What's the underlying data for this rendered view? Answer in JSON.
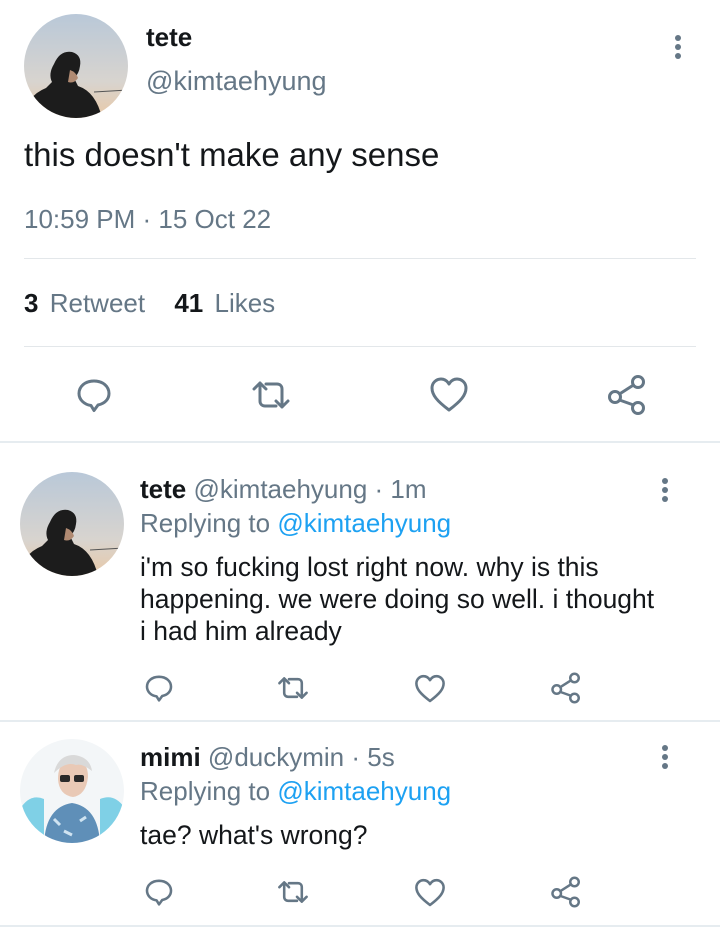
{
  "main_tweet": {
    "display_name": "tete",
    "handle": "@kimtaehyung",
    "text": "this doesn't make any sense",
    "timestamp": "10:59 PM · 15 Oct 22",
    "retweet_count": "3",
    "retweet_label": "Retweet",
    "like_count": "41",
    "like_label": "Likes"
  },
  "replies": [
    {
      "display_name": "tete",
      "handle_time": "@kimtaehyung · 1m",
      "replying_prefix": "Replying to",
      "replying_to": "@kimtaehyung",
      "text": "i'm so fucking lost right now. why is this happening. we were doing so well. i thought i had him already"
    },
    {
      "display_name": "mimi",
      "handle_time": "@duckymin · 5s",
      "replying_prefix": "Replying to",
      "replying_to": "@kimtaehyung",
      "text": "tae? what's wrong?"
    }
  ],
  "icons": {
    "reply": "comment-icon",
    "retweet": "retweet-icon",
    "like": "heart-icon",
    "share": "share-icon",
    "menu": "more-vertical-icon"
  },
  "colors": {
    "link": "#1da1f2",
    "muted": "#657786",
    "icon": "#657786"
  }
}
